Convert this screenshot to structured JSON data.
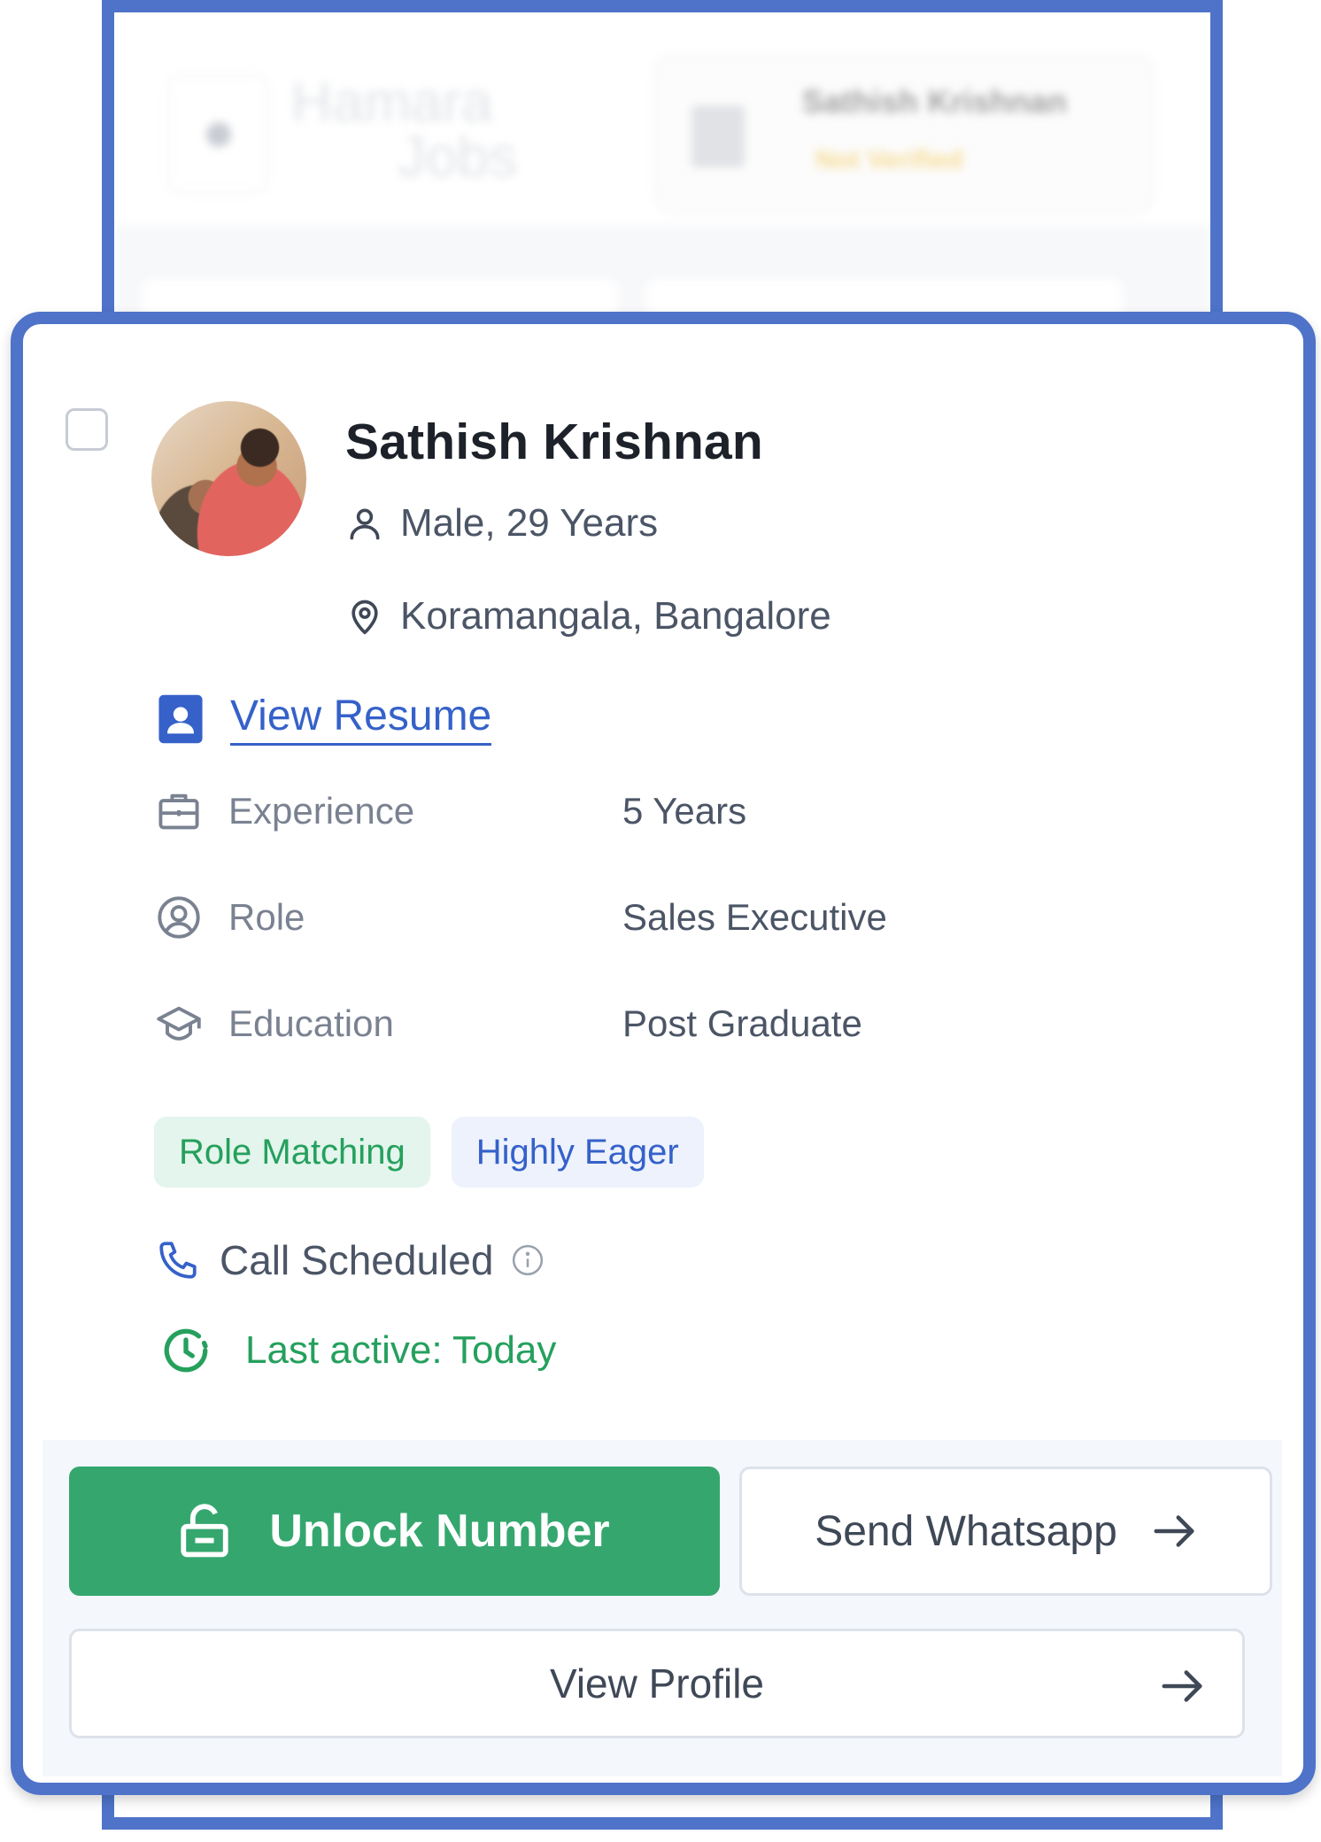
{
  "background": {
    "logo_line1": "Hamara",
    "logo_line2": "Jobs",
    "user_name": "Sathish Krishnan",
    "user_status": "Not Verified"
  },
  "candidate": {
    "name": "Sathish Krishnan",
    "gender_age": "Male, 29 Years",
    "location": "Koramangala, Bangalore",
    "resume_link": "View Resume",
    "details": [
      {
        "label": "Experience",
        "value": "5 Years",
        "icon": "briefcase-icon"
      },
      {
        "label": "Role",
        "value": "Sales Executive",
        "icon": "user-circle-icon"
      },
      {
        "label": "Education",
        "value": "Post Graduate",
        "icon": "graduation-cap-icon"
      }
    ],
    "tags": [
      {
        "label": "Role Matching",
        "color": "#25a05d"
      },
      {
        "label": "Highly Eager",
        "color": "#3561c9"
      }
    ],
    "call_status": "Call Scheduled",
    "last_active": "Last active: Today"
  },
  "actions": {
    "unlock_label": "Unlock Number",
    "whatsapp_label": "Send Whatsapp",
    "profile_label": "View Profile"
  },
  "colors": {
    "frame": "#4e73c9",
    "primary_green": "#35a76e",
    "link_blue": "#3561c9"
  }
}
